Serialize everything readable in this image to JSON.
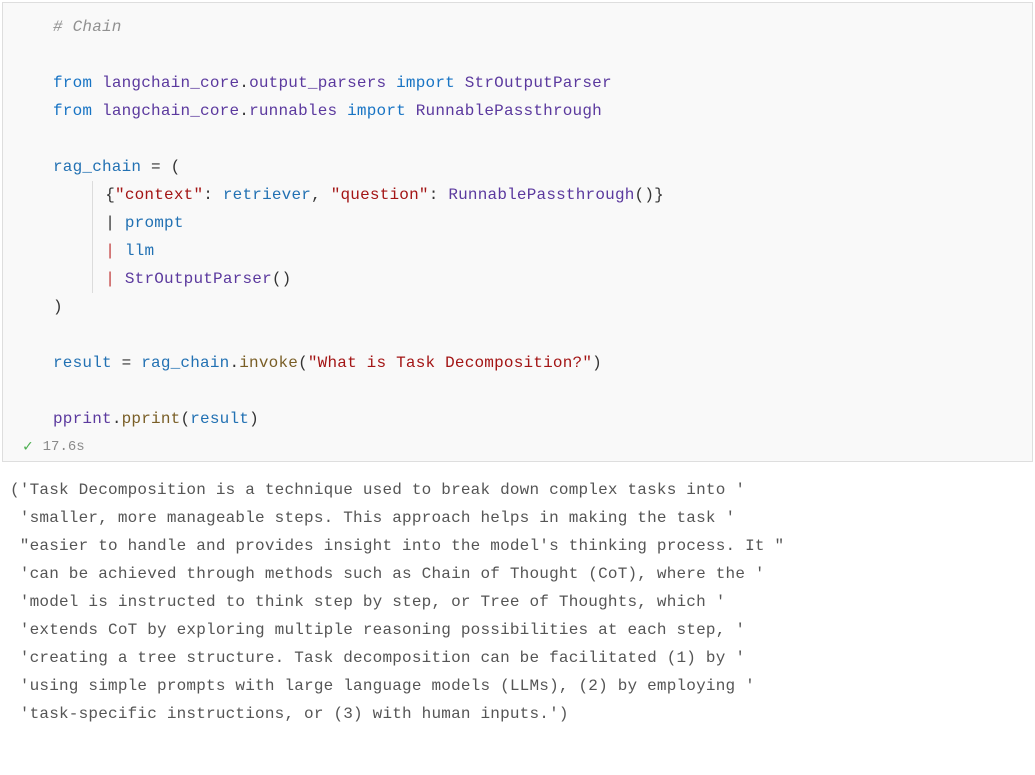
{
  "cell": {
    "exec_status": "success",
    "exec_time": "17.6s"
  },
  "code": {
    "l1_comment": "# Chain",
    "l3_from": "from",
    "l3_mod1": "langchain_core",
    "l3_mod2": "output_parsers",
    "l3_import": "import",
    "l3_name": "StrOutputParser",
    "l4_from": "from",
    "l4_mod1": "langchain_core",
    "l4_mod2": "runnables",
    "l4_import": "import",
    "l4_name": "RunnablePassthrough",
    "l6_var": "rag_chain",
    "l6_eq": " = (",
    "l7_key1": "\"context\"",
    "l7_val1": "retriever",
    "l7_key2": "\"question\"",
    "l7_val2": "RunnablePassthrough",
    "l8_pipe": "|",
    "l8_val": "prompt",
    "l9_pipe": "|",
    "l9_val": "llm",
    "l10_pipe": "|",
    "l10_val": "StrOutputParser",
    "l11_close": ")",
    "l13_var": "result",
    "l13_eq": " = ",
    "l13_obj": "rag_chain",
    "l13_fn": "invoke",
    "l13_arg": "\"What is Task Decomposition?\"",
    "l15_obj": "pprint",
    "l15_fn": "pprint",
    "l15_arg": "result"
  },
  "output": {
    "line1": "('Task Decomposition is a technique used to break down complex tasks into '",
    "line2": " 'smaller, more manageable steps. This approach helps in making the task '",
    "line3": " \"easier to handle and provides insight into the model's thinking process. It \"",
    "line4": " 'can be achieved through methods such as Chain of Thought (CoT), where the '",
    "line5": " 'model is instructed to think step by step, or Tree of Thoughts, which '",
    "line6": " 'extends CoT by exploring multiple reasoning possibilities at each step, '",
    "line7": " 'creating a tree structure. Task decomposition can be facilitated (1) by '",
    "line8": " 'using simple prompts with large language models (LLMs), (2) by employing '",
    "line9": " 'task-specific instructions, or (3) with human inputs.')"
  }
}
